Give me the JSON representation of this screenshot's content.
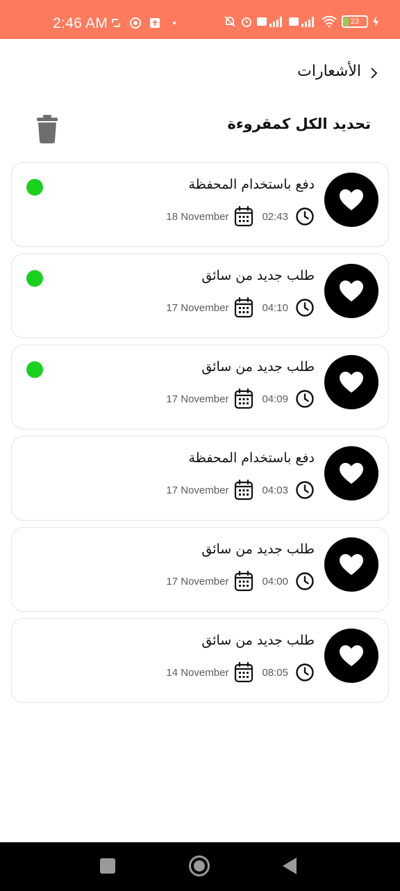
{
  "status_bar": {
    "time": "2:46 AM",
    "battery": "23",
    "color": "#fe7a5c"
  },
  "header": {
    "title": "الأشعارات",
    "back_icon": "chevron-right-icon"
  },
  "actions": {
    "mark_all_read": "تحديد الكل كمقروءة",
    "delete_icon": "trash-icon"
  },
  "notifications": [
    {
      "title": "دفع باستخدام المحفظة",
      "time": "02:43",
      "date": "18 November",
      "unread": true
    },
    {
      "title": "طلب جديد من سائق",
      "time": "04:10",
      "date": "17 November",
      "unread": true
    },
    {
      "title": "طلب جديد من سائق",
      "time": "04:09",
      "date": "17 November",
      "unread": true
    },
    {
      "title": "دفع باستخدام المحفظة",
      "time": "04:03",
      "date": "17 November",
      "unread": false
    },
    {
      "title": "طلب جديد من سائق",
      "time": "04:00",
      "date": "17 November",
      "unread": false
    },
    {
      "title": "طلب جديد من سائق",
      "time": "08:05",
      "date": "14 November",
      "unread": false
    }
  ],
  "colors": {
    "unread_dot": "#19d11d",
    "avatar_bg": "#000000"
  }
}
